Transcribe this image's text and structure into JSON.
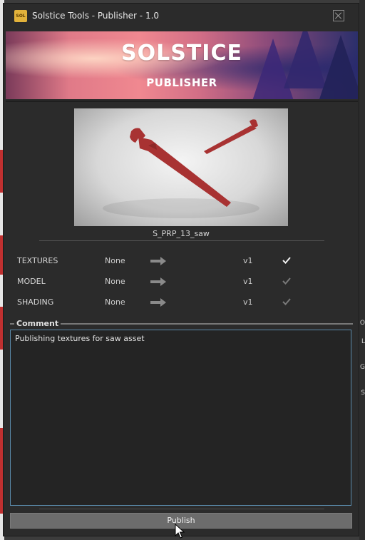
{
  "window": {
    "title": "Solstice Tools - Publisher - 1.0",
    "app_icon_text": "SOL"
  },
  "banner": {
    "logo_text": "SOLSTICE",
    "subtitle": "PUBLISHER"
  },
  "preview": {
    "asset_name": "S_PRP_13_saw",
    "accent": "#a83232"
  },
  "publish_rows": [
    {
      "category": "TEXTURES",
      "source": "None",
      "version": "v1",
      "checked": true
    },
    {
      "category": "MODEL",
      "source": "None",
      "version": "v1",
      "checked": true
    },
    {
      "category": "SHADING",
      "source": "None",
      "version": "v1",
      "checked": true
    }
  ],
  "comment": {
    "legend": "Comment",
    "text": "Publishing textures for saw asset"
  },
  "publish_button": {
    "label": "Publish"
  },
  "background_right": {
    "letters": [
      "O",
      "L",
      "G",
      "S"
    ]
  },
  "colors": {
    "window_bg": "#2b2b2b",
    "focus_border": "#5b8bab",
    "button_bg": "#6c6c6c"
  }
}
